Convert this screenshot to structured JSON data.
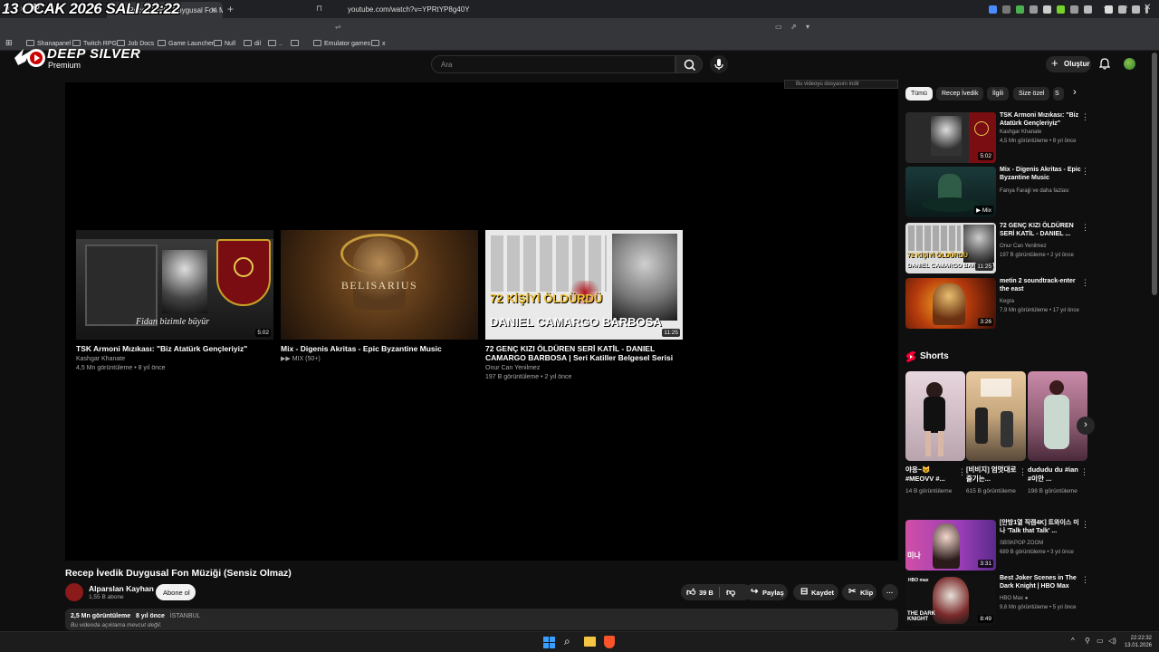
{
  "overlay_date": "13 OCAK 2026 SALI 22:22",
  "browser": {
    "tab_title": "Recep İvedik Duygusal Fon Müziği",
    "url": "youtube.com/watch?v=YPRtYP8g40Y",
    "bookmarks": [
      "Shanapanel",
      "Twitch RPG",
      "Job Docs",
      "Game Launcher",
      "Null",
      "dil",
      "..",
      "",
      "Emulator games",
      "x"
    ]
  },
  "header": {
    "logo_text": "DEEP SILVER",
    "premium": "Premium",
    "search_placeholder": "Ara",
    "create_label": "Oluştur"
  },
  "player": {
    "save_tooltip": "Bu videoyu dosyasını indir",
    "end_cards": [
      {
        "title": "TSK Armoni Mızıkası: \"Biz Atatürk Gençleriyiz\"",
        "channel": "Kashgar Khanate",
        "meta": "4,5 Mn görüntüleme • 8 yıl önce",
        "duration": "5:02",
        "thumb_caption": "Fidan bizimle büyür"
      },
      {
        "title": "Mix - Digenis Akritas - Epic Byzantine Music",
        "channel": "MIX (50+)",
        "meta": "",
        "duration": "",
        "thumb_caption": "BELISARIUS"
      },
      {
        "title": "72 GENÇ KIZI ÖLDÜREN SERİ KATİL - DANIEL CAMARGO BARBOSA | Seri Katiller Belgesel Serisi",
        "channel": "Onur Can Yenilmez",
        "meta": "197 B görüntüleme • 2 yıl önce",
        "duration": "11:25",
        "thumb_caption_1": "72 KİŞİYİ ÖLDÜRDÜ",
        "thumb_caption_2": "DANIEL CAMARGO BARBOSA"
      }
    ]
  },
  "video": {
    "title": "Recep İvedik Duygusal Fon Müziği (Sensiz Olmaz)",
    "channel": "Alparslan Kayhan",
    "subscribers": "1,55 B abone",
    "subscribe_label": "Abone ol",
    "like_count": "39 B",
    "share_label": "Paylaş",
    "save_label": "Kaydet",
    "clip_label": "Klip",
    "views": "2,5 Mn görüntüleme",
    "age": "8 yıl önce",
    "location": "İSTANBUL",
    "description": "Bu videoda açıklama mevcut değil."
  },
  "sidebar": {
    "chips": [
      "Tümü",
      "Recep İvedik",
      "İlgili",
      "Size özel",
      "S"
    ],
    "recommendations": [
      {
        "title": "TSK Armoni Mızıkası: \"Biz Atatürk Gençleriyiz\"",
        "channel": "Kashgar Khanate",
        "meta": "4,5 Mn görüntüleme • 8 yıl önce",
        "duration": "5:02"
      },
      {
        "title": "Mix - Digenis Akritas - Epic Byzantine Music",
        "channel": "Fanya Farajji ve daha fazlası",
        "meta": "",
        "duration": "Mix"
      },
      {
        "title": "72 GENÇ KIZI ÖLDÜREN SERİ KATİL - DANIEL ...",
        "channel": "Onur Can Yenilmez",
        "meta": "197 B görüntüleme • 2 yıl önce",
        "duration": "11:25"
      },
      {
        "title": "metin 2 soundtrack-enter the east",
        "channel": "Kegra",
        "meta": "7,9 Mn görüntüleme • 17 yıl önce",
        "duration": "3:26"
      }
    ],
    "shorts_heading": "Shorts",
    "shorts": [
      {
        "title": "야옹~😺 #MEOVV #...",
        "views": "14 B görüntüleme"
      },
      {
        "title": "[비비지] 엄멋대로 즐기는...",
        "views": "615 B görüntüleme"
      },
      {
        "title": "dududu du #ian #이안 ...",
        "views": "198 B görüntüleme"
      }
    ],
    "recommendations2": [
      {
        "title": "[안방1열 직캠4K] 트와이스 미나 'Talk that Talk' ...",
        "channel": "SBSKPOP ZOOM",
        "meta": "689 B görüntüleme • 3 yıl önce",
        "duration": "3:31"
      },
      {
        "title": "Best Joker Scenes in The Dark Knight | HBO Max",
        "channel": "HBO Max",
        "meta": "9,6 Mn görüntüleme • 5 yıl önce",
        "duration": "8:49"
      }
    ]
  },
  "taskbar": {
    "time": "22:22:32",
    "date": "13.01.2026"
  }
}
